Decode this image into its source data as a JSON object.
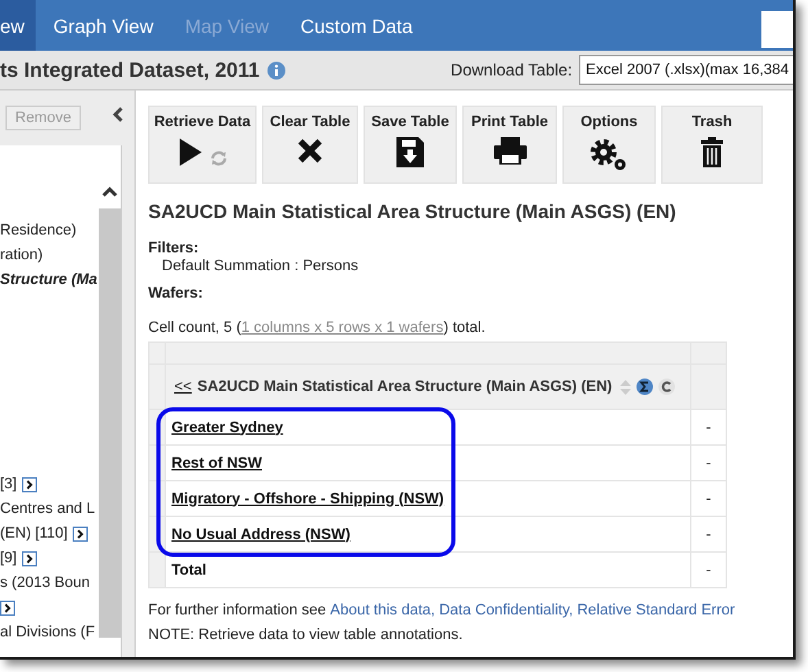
{
  "nav": {
    "tabs": [
      {
        "label": "ew",
        "selected": true,
        "disabled": false
      },
      {
        "label": "Graph View",
        "selected": false,
        "disabled": false
      },
      {
        "label": "Map View",
        "selected": false,
        "disabled": true
      },
      {
        "label": "Custom Data",
        "selected": false,
        "disabled": false
      }
    ]
  },
  "title_bar": {
    "title": "ts Integrated Dataset, 2011",
    "download_label": "Download Table:",
    "download_value": "Excel 2007 (.xlsx)(max 16,384"
  },
  "sidebar": {
    "remove_button": "Remove",
    "groups": [
      [
        {
          "kind": "text",
          "text": "Residence)"
        },
        {
          "kind": "text",
          "text": "ration)"
        },
        {
          "kind": "current",
          "text": "Structure (Ma"
        }
      ],
      [
        {
          "kind": "expand",
          "text": "[3]"
        },
        {
          "kind": "text",
          "text": "Centres and L"
        },
        {
          "kind": "expand",
          "text": "(EN) [110]"
        },
        {
          "kind": "expand",
          "text": "[9]"
        },
        {
          "kind": "text",
          "text": "s (2013 Boun"
        },
        {
          "kind": "expand"
        },
        {
          "kind": "text",
          "text": "al Divisions (F"
        }
      ]
    ]
  },
  "toolbar": [
    {
      "kind": "retrieve",
      "label": "Retrieve Data"
    },
    {
      "kind": "clear",
      "label": "Clear Table"
    },
    {
      "kind": "save",
      "label": "Save Table"
    },
    {
      "kind": "print",
      "label": "Print Table"
    },
    {
      "kind": "options",
      "label": "Options"
    },
    {
      "kind": "trash",
      "label": "Trash"
    }
  ],
  "heading": "SA2UCD Main Statistical Area Structure (Main ASGS) (EN)",
  "filters": {
    "label": "Filters:",
    "value": "Default Summation : Persons"
  },
  "wafers": {
    "label": "Wafers:"
  },
  "cell_count": {
    "before": "Cell count, 5 (",
    "link": "1 columns x 5 rows x 1 wafers",
    "after": ") total."
  },
  "table": {
    "back_link": "<<",
    "column_header": "SA2UCD Main Statistical Area Structure (Main ASGS) (EN)",
    "rows": [
      {
        "label": "Greater Sydney",
        "linked": true,
        "value": "-"
      },
      {
        "label": "Rest of NSW",
        "linked": true,
        "value": "-"
      },
      {
        "label": "Migratory - Offshore - Shipping (NSW)",
        "linked": true,
        "value": "-"
      },
      {
        "label": "No Usual Address (NSW)",
        "linked": true,
        "value": "-"
      },
      {
        "label": "Total",
        "linked": false,
        "value": "-"
      }
    ]
  },
  "footer": {
    "text": "For further information see",
    "links": [
      "About this data,",
      "Data Confidentiality,",
      "Relative Standard Error"
    ],
    "note": "NOTE: Retrieve data to view table annotations."
  }
}
